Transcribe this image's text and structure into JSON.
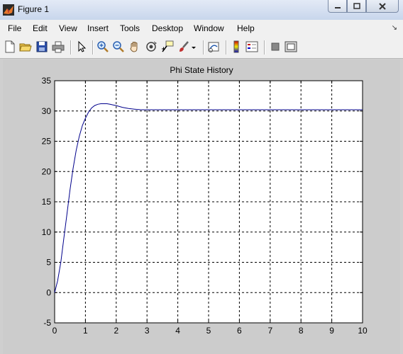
{
  "window": {
    "title": "Figure 1",
    "accent": "#c8d6ec"
  },
  "menu": [
    "File",
    "Edit",
    "View",
    "Insert",
    "Tools",
    "Desktop",
    "Window",
    "Help"
  ],
  "toolbar": [
    "new-figure-icon",
    "open-file-icon",
    "save-icon",
    "print-icon",
    "edit-plot-arrow-icon",
    "zoom-in-icon",
    "zoom-out-icon",
    "pan-hand-icon",
    "rotate-3d-icon",
    "data-cursor-icon",
    "brush-icon",
    "brush-dropdown-icon",
    "link-plot-icon",
    "colorbar-icon",
    "legend-icon",
    "hide-plot-tools-icon",
    "show-plot-tools-icon"
  ],
  "chart_data": {
    "type": "line",
    "title": "Phi State History",
    "xlabel": "",
    "ylabel": "",
    "xlim": [
      0,
      10
    ],
    "ylim": [
      -5,
      35
    ],
    "xticks": [
      0,
      1,
      2,
      3,
      4,
      5,
      6,
      7,
      8,
      9,
      10
    ],
    "yticks": [
      -5,
      0,
      5,
      10,
      15,
      20,
      25,
      30,
      35
    ],
    "grid": true,
    "line_color": "#00008b",
    "series": [
      {
        "x": [
          0,
          0.1,
          0.2,
          0.3,
          0.4,
          0.5,
          0.6,
          0.7,
          0.8,
          0.9,
          1.0,
          1.1,
          1.2,
          1.3,
          1.4,
          1.5,
          1.6,
          1.7,
          1.8,
          1.9,
          2.0,
          2.2,
          2.4,
          2.6,
          2.8,
          3.0,
          3.5,
          4,
          5,
          6,
          7,
          8,
          9,
          10
        ],
        "y": [
          0,
          2,
          5,
          9,
          13,
          17,
          20.5,
          23.5,
          25.8,
          27.6,
          28.8,
          29.8,
          30.5,
          30.9,
          31.1,
          31.2,
          31.2,
          31.2,
          31.1,
          31.0,
          30.9,
          30.6,
          30.4,
          30.3,
          30.2,
          30.2,
          30.2,
          30.2,
          30.2,
          30.2,
          30.2,
          30.2,
          30.2,
          30.2
        ]
      }
    ]
  }
}
